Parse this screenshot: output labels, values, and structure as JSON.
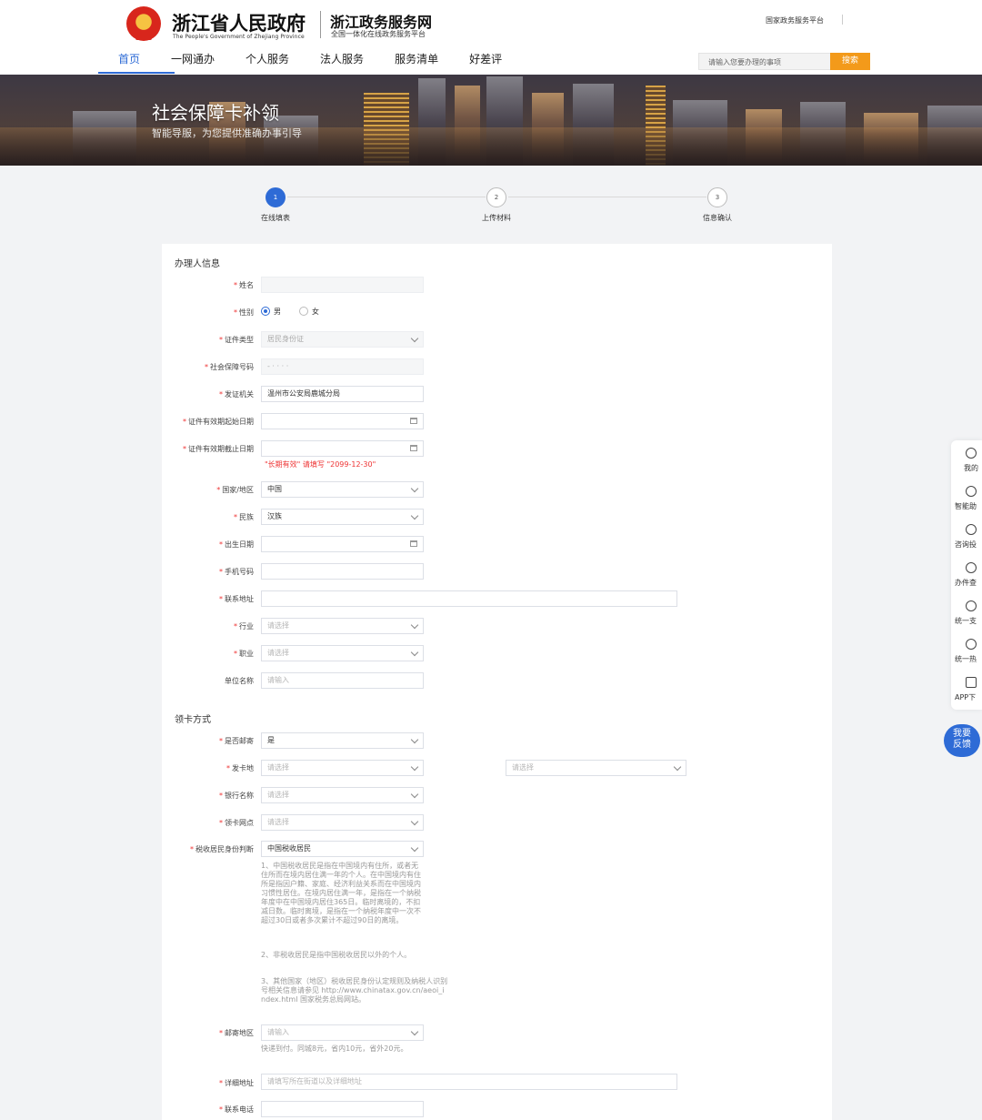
{
  "header": {
    "brand_cn": "浙江省人民政府",
    "brand_en": "The People's Government of Zhejiang Province",
    "site_cn": "浙江政务服务网",
    "site_sub": "全国一体化在线政务服务平台",
    "national_link": "国家政务服务平台",
    "nav": [
      "首页",
      "一网通办",
      "个人服务",
      "法人服务",
      "服务清单",
      "好差评"
    ],
    "search_placeholder": "请输入您要办理的事项",
    "search_button": "搜索"
  },
  "banner": {
    "title": "社会保障卡补领",
    "subtitle": "智能导服，为您提供准确办事引导"
  },
  "steps": [
    {
      "num": "1",
      "label": "在线填表"
    },
    {
      "num": "2",
      "label": "上传材料"
    },
    {
      "num": "3",
      "label": "信息确认"
    }
  ],
  "form": {
    "section_applicant": "办理人信息",
    "section_card": "领卡方式",
    "name_label": "姓名",
    "gender_label": "性别",
    "gender_male": "男",
    "gender_female": "女",
    "id_type_label": "证件类型",
    "id_type_value": "居民身份证",
    "ss_no_label": "社会保障号码",
    "ss_no_value": "- ·  ·  ·  ·",
    "issuer_label": "发证机关",
    "issuer_value": "温州市公安局鹿城分局",
    "valid_start_label": "证件有效期起始日期",
    "valid_end_label": "证件有效期截止日期",
    "valid_hint": "\"长期有效\" 请填写 \"2099-12-30\"",
    "country_label": "国家/地区",
    "country_value": "中国",
    "ethnic_label": "民族",
    "ethnic_value": "汉族",
    "birth_label": "出生日期",
    "phone_label": "手机号码",
    "address_label": "联系地址",
    "industry_label": "行业",
    "occupation_label": "职业",
    "company_label": "单位名称",
    "ph_select": "请选择",
    "ph_input": "请输入",
    "mail_label": "是否邮寄",
    "mail_value": "是",
    "card_place_label": "发卡地",
    "bank_label": "银行名称",
    "branch_label": "领卡网点",
    "tax_label": "税收居民身份判断",
    "tax_value": "中国税收居民",
    "tax_note_1": "1、中国税收居民是指在中国境内有住所，或者无住所而在境内居住满一年的个人。在中国境内有住所是指因户籍、家庭、经济利益关系而在中国境内习惯性居住。在境内居住满一年，是指在一个纳税年度中在中国境内居住365日。临时离境的，不扣减日数。临时离境，是指在一个纳税年度中一次不超过30日或者多次累计不超过90日的离境。",
    "tax_note_2": "2、非税收居民是指中国税收居民以外的个人。",
    "tax_note_3": "3、其他国家（地区）税收居民身份认定规则及纳税人识别号相关信息请参见 http://www.chinatax.gov.cn/aeoi_index.html 国家税务总局网站。",
    "mail_region_label": "邮寄地区",
    "mail_note": "快递到付。同城8元，省内10元，省外20元。",
    "detail_addr_label": "详细地址",
    "detail_addr_ph": "请填写所在街道以及详细地址",
    "contact_phone_label": "联系电话"
  },
  "sidebar": [
    "我的",
    "智能助",
    "咨询投",
    "办件查",
    "统一支",
    "统一热",
    "APP下"
  ],
  "feedback": [
    "我要",
    "反馈"
  ],
  "colors": {
    "primary": "#2e6bd6",
    "accent": "#f39a1a",
    "required": "#e33333"
  }
}
